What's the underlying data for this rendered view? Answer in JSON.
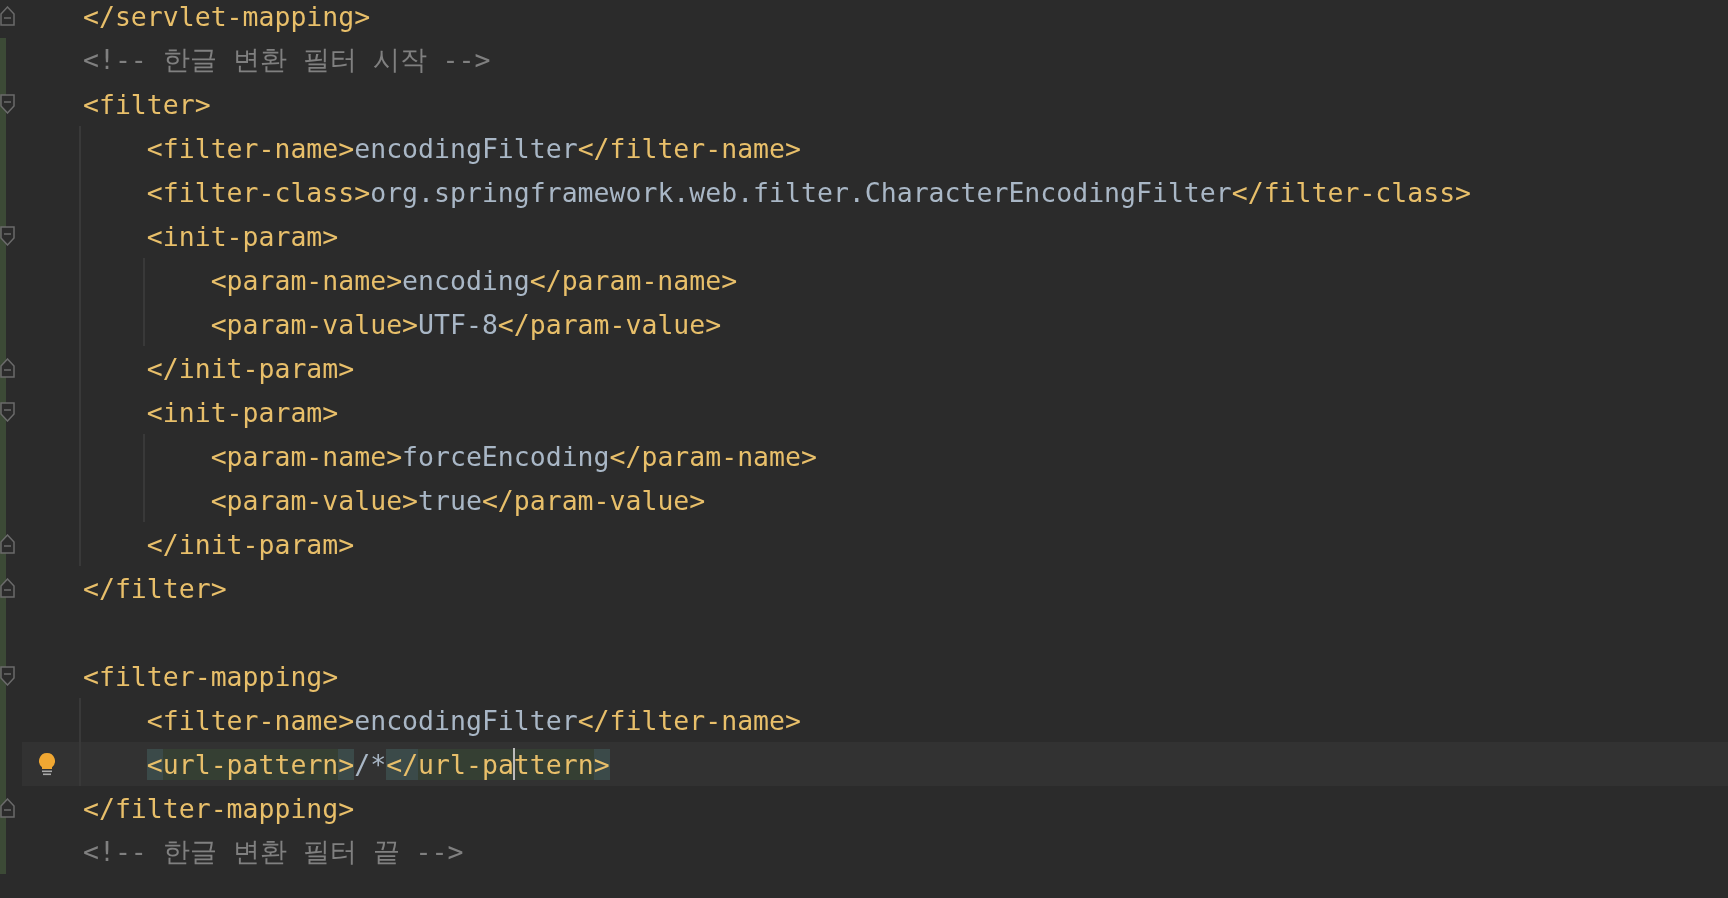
{
  "editor": {
    "lines": [
      {
        "changed": false,
        "current": false,
        "fold_open": false,
        "fold_close": true,
        "tokens": [
          {
            "kind": "tag",
            "text": "</servlet-mapping>"
          }
        ]
      },
      {
        "changed": true,
        "current": false,
        "fold_open": false,
        "fold_close": false,
        "tokens": [
          {
            "kind": "comment",
            "text": "<!-- 한글 변환 필터 시작 -->"
          }
        ]
      },
      {
        "changed": true,
        "current": false,
        "fold_open": true,
        "fold_close": false,
        "tokens": [
          {
            "kind": "tag",
            "text": "<filter>"
          }
        ]
      },
      {
        "changed": true,
        "current": false,
        "fold_open": false,
        "fold_close": false,
        "tokens": [
          {
            "kind": "tag",
            "text": "    <filter-name>"
          },
          {
            "kind": "text",
            "text": "encodingFilter"
          },
          {
            "kind": "tag",
            "text": "</filter-name>"
          }
        ]
      },
      {
        "changed": true,
        "current": false,
        "fold_open": false,
        "fold_close": false,
        "tokens": [
          {
            "kind": "tag",
            "text": "    <filter-class>"
          },
          {
            "kind": "text",
            "text": "org.springframework.web.filter.CharacterEncodingFilter"
          },
          {
            "kind": "tag",
            "text": "</filter-class>"
          }
        ]
      },
      {
        "changed": true,
        "current": false,
        "fold_open": true,
        "fold_close": false,
        "tokens": [
          {
            "kind": "tag",
            "text": "    <init-param>"
          }
        ]
      },
      {
        "changed": true,
        "current": false,
        "fold_open": false,
        "fold_close": false,
        "tokens": [
          {
            "kind": "tag",
            "text": "        <param-name>"
          },
          {
            "kind": "text",
            "text": "encoding"
          },
          {
            "kind": "tag",
            "text": "</param-name>"
          }
        ]
      },
      {
        "changed": true,
        "current": false,
        "fold_open": false,
        "fold_close": false,
        "tokens": [
          {
            "kind": "tag",
            "text": "        <param-value>"
          },
          {
            "kind": "text",
            "text": "UTF-8"
          },
          {
            "kind": "tag",
            "text": "</param-value>"
          }
        ]
      },
      {
        "changed": true,
        "current": false,
        "fold_open": false,
        "fold_close": true,
        "tokens": [
          {
            "kind": "tag",
            "text": "    </init-param>"
          }
        ]
      },
      {
        "changed": true,
        "current": false,
        "fold_open": true,
        "fold_close": false,
        "tokens": [
          {
            "kind": "tag",
            "text": "    <init-param>"
          }
        ]
      },
      {
        "changed": true,
        "current": false,
        "fold_open": false,
        "fold_close": false,
        "tokens": [
          {
            "kind": "tag",
            "text": "        <param-name>"
          },
          {
            "kind": "text",
            "text": "forceEncoding"
          },
          {
            "kind": "tag",
            "text": "</param-name>"
          }
        ]
      },
      {
        "changed": true,
        "current": false,
        "fold_open": false,
        "fold_close": false,
        "tokens": [
          {
            "kind": "tag",
            "text": "        <param-value>"
          },
          {
            "kind": "text",
            "text": "true"
          },
          {
            "kind": "tag",
            "text": "</param-value>"
          }
        ]
      },
      {
        "changed": true,
        "current": false,
        "fold_open": false,
        "fold_close": true,
        "tokens": [
          {
            "kind": "tag",
            "text": "    </init-param>"
          }
        ]
      },
      {
        "changed": true,
        "current": false,
        "fold_open": false,
        "fold_close": true,
        "tokens": [
          {
            "kind": "tag",
            "text": "</filter>"
          }
        ]
      },
      {
        "changed": true,
        "current": false,
        "fold_open": false,
        "fold_close": false
      },
      {
        "changed": true,
        "current": false,
        "fold_open": true,
        "fold_close": false,
        "tokens": [
          {
            "kind": "tag",
            "text": "<filter-mapping>"
          }
        ]
      },
      {
        "changed": true,
        "current": false,
        "fold_open": false,
        "fold_close": false,
        "tokens": [
          {
            "kind": "tag",
            "text": "    <filter-name>"
          },
          {
            "kind": "text",
            "text": "encodingFilter"
          },
          {
            "kind": "tag",
            "text": "</filter-name>"
          }
        ]
      },
      {
        "changed": true,
        "current": true,
        "intention_bulb": true,
        "fold_open": false,
        "fold_close": false,
        "tokens": [
          {
            "kind": "bracket",
            "text": "    <"
          },
          {
            "kind": "tag-name",
            "text": "url-pattern"
          },
          {
            "kind": "bracket",
            "text": ">"
          },
          {
            "kind": "text",
            "text": "/*"
          },
          {
            "kind": "bracket",
            "text": "</"
          },
          {
            "kind": "tag-name",
            "text": "url-pa",
            "caret_after": true
          },
          {
            "kind": "tag-name",
            "text": "ttern",
            "caret_after": false
          },
          {
            "kind": "bracket",
            "text": ">"
          }
        ]
      },
      {
        "changed": true,
        "current": false,
        "fold_open": false,
        "fold_close": true,
        "tokens": [
          {
            "kind": "tag",
            "text": "</filter-mapping>"
          }
        ]
      },
      {
        "changed": true,
        "current": false,
        "fold_open": false,
        "fold_close": false,
        "tokens": [
          {
            "kind": "comment",
            "text": "<!-- 한글 변환 필터 끝 -->"
          }
        ]
      }
    ]
  }
}
